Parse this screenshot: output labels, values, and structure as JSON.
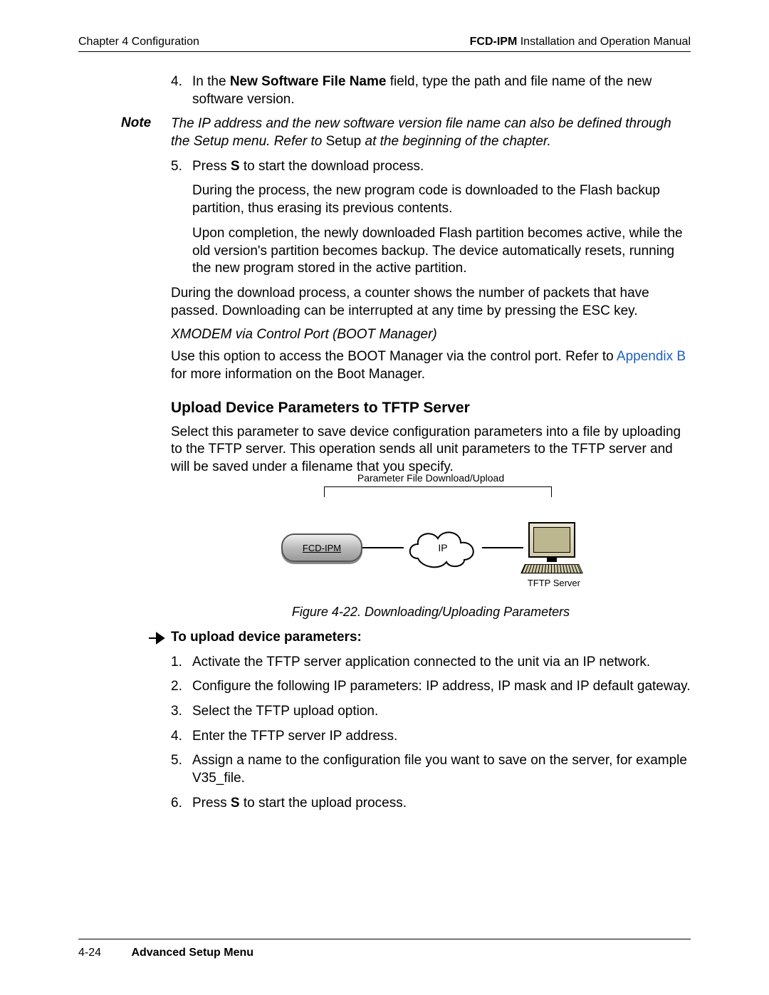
{
  "header": {
    "left": "Chapter 4  Configuration",
    "right_bold": "FCD-IPM",
    "right_rest": " Installation and Operation Manual"
  },
  "step4": {
    "num": "4.",
    "pre": "In the ",
    "bold": "New Software File Name",
    "post": " field, type the path and file name of the new software version."
  },
  "note": {
    "label": "Note",
    "text_pre": "The IP address and the new software version file name can also be defined through the Setup menu. Refer to ",
    "text_roman": "Setup",
    "text_post": " at the beginning of the chapter."
  },
  "step5": {
    "num": "5.",
    "pre": "Press ",
    "bold": "S",
    "post": " to start the download process."
  },
  "step5_p1": "During the process, the new program code is downloaded to the Flash backup partition, thus erasing its previous contents.",
  "step5_p2": "Upon completion, the newly downloaded Flash partition becomes active, while the old version's partition becomes backup. The device automatically resets, running the new program stored in the active partition.",
  "dl_para": "During the download process, a counter shows the number of packets that have passed. Downloading can be interrupted at any time by pressing the ESC key.",
  "xmodem_head": "XMODEM via Control Port (BOOT Manager)",
  "xmodem_p_pre": "Use this option to access the BOOT Manager via the control port. Refer to ",
  "xmodem_link": "Appendix B",
  "xmodem_p_post": " for more information on the Boot Manager.",
  "h3": "Upload Device Parameters to TFTP Server",
  "upload_intro": "Select this parameter to save device configuration parameters into a file by uploading to the TFTP server. This operation sends all unit parameters to the TFTP server and will be saved under a filename that you specify.",
  "diagram": {
    "bracket": "Parameter File Download/Upload",
    "modem": "FCD-IPM",
    "cloud": "IP",
    "server": "TFTP Server"
  },
  "fig_caption": "Figure 4-22.  Downloading/Uploading Parameters",
  "proc_title": "To upload device parameters:",
  "steps": {
    "s1": {
      "num": "1.",
      "txt": "Activate the TFTP server application connected to the unit via an IP network."
    },
    "s2": {
      "num": "2.",
      "txt": "Configure the following IP parameters: IP address, IP mask and IP default gateway."
    },
    "s3": {
      "num": "3.",
      "txt": "Select the TFTP upload option."
    },
    "s4": {
      "num": "4.",
      "txt": "Enter the TFTP server IP address."
    },
    "s5": {
      "num": "5.",
      "txt": "Assign a name to the configuration file you want to save on the server, for example V35_file."
    },
    "s6": {
      "num": "6.",
      "pre": "Press ",
      "bold": "S",
      "post": " to start the upload process."
    }
  },
  "footer": {
    "page": "4-24",
    "section": "Advanced Setup Menu"
  }
}
